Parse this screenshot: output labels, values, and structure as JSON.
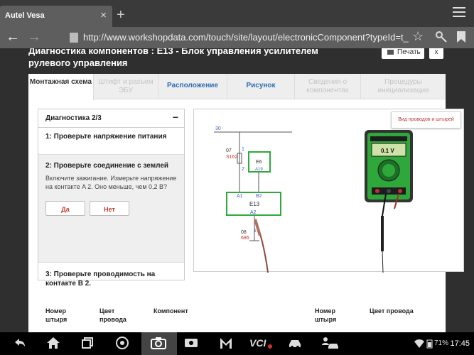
{
  "browser": {
    "tab_title": "Autel Vesa",
    "tab_close": "×",
    "new_tab": "+",
    "url": "http://www.workshopdata.com/touch/site/layout/electronicComponent?typeId=t_"
  },
  "page": {
    "title": "Диагностика компонентов : E13 - Блок управления усилителем рулевого управления",
    "print_label": "Печать",
    "close_label": "x"
  },
  "tabs": [
    {
      "label": "Монтажная схема",
      "state": "active"
    },
    {
      "label": "Штифт и разъем ЭБУ",
      "state": "disabled"
    },
    {
      "label": "Расположение",
      "state": "link"
    },
    {
      "label": "Рисунок",
      "state": "link"
    },
    {
      "label": "Сведения о компонентах",
      "state": "disabled"
    },
    {
      "label": "Процедуры инициализации",
      "state": "disabled"
    }
  ],
  "steps": {
    "header": "Диагностика 2/3",
    "collapse": "−",
    "step1": "1: Проверьте напряжение питания",
    "step2_title": "2: Проверьте соединение с землей",
    "step2_desc": "Включите зажигание. Измерьте напряжение на контакте A 2. Оно меньше, чем 0,2 В?",
    "yes": "Да",
    "no": "Нет",
    "step3": "3: Проверьте проводимость на контакте B 2."
  },
  "diagram": {
    "wires_button": "Вид проводов и штырей",
    "labels": {
      "bus": "30",
      "wire07": "07",
      "wire07_color": "S162",
      "pin1": "1",
      "pin2": "2",
      "e6": "E6",
      "e6_pin": "A19",
      "a1": "A1",
      "b2": "B2",
      "e13": "E13",
      "a2": "A2",
      "pin1b": "1",
      "wire08": "08",
      "wire08_color": "686"
    },
    "meter_reading": "0.1 V"
  },
  "table": {
    "col1": "Номер штыря",
    "col2": "Цвет провода",
    "col3": "Компонент",
    "col4": "Номер штыря",
    "col5": "Цвет провода"
  },
  "status": {
    "battery": "71%",
    "time": "17:45"
  }
}
